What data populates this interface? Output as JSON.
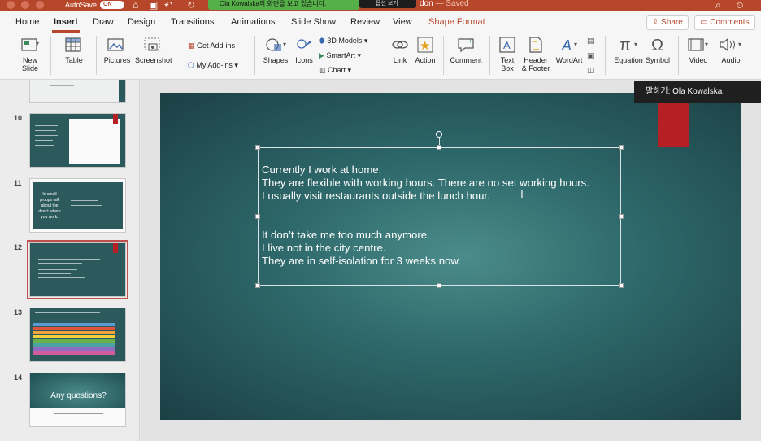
{
  "titlebar": {
    "autosave_label": "AutoSave",
    "autosave_toggle": "ON",
    "banner_text": "Ola Kowalska의 화면을 보고 있습니다.",
    "banner_dark_text": "옵션 보기",
    "doc_name_fragment": "don",
    "doc_status": "— Saved",
    "accent": "#b7472a"
  },
  "tabs": [
    "Home",
    "Insert",
    "Draw",
    "Design",
    "Transitions",
    "Animations",
    "Slide Show",
    "Review",
    "View",
    "Shape Format"
  ],
  "active_tab": "Insert",
  "share_label": "Share",
  "comments_label": "Comments",
  "ribbon": {
    "new_slide": "New Slide",
    "table": "Table",
    "pictures": "Pictures",
    "screenshot": "Screenshot",
    "get_addins": "Get Add-ins",
    "my_addins": "My Add-ins",
    "shapes": "Shapes",
    "icons": "Icons",
    "models3d": "3D Models",
    "smartart": "SmartArt",
    "chart": "Chart",
    "link": "Link",
    "action": "Action",
    "comment": "Comment",
    "text_box": "Text Box",
    "header_footer": "Header & Footer",
    "wordart": "WordArt",
    "equation": "Equation",
    "symbol": "Symbol",
    "video": "Video",
    "audio": "Audio"
  },
  "thumbnails": [
    {
      "num": "10"
    },
    {
      "num": "11",
      "title": "In small groups talk about the direct where you work."
    },
    {
      "num": "12"
    },
    {
      "num": "13"
    },
    {
      "num": "14",
      "title": "Any questions?"
    }
  ],
  "slide": {
    "lines": [
      "Currently I work at home.",
      "They are flexible with working hours. There are no set working hours.",
      "I usually visit restaurants outside the lunch hour.",
      "",
      "",
      "It don’t take me too much anymore.",
      "I live not in the city centre.",
      "They are in self-isolation for 3 weeks now."
    ]
  },
  "tooltip": "말하기: Ola Kowalska"
}
